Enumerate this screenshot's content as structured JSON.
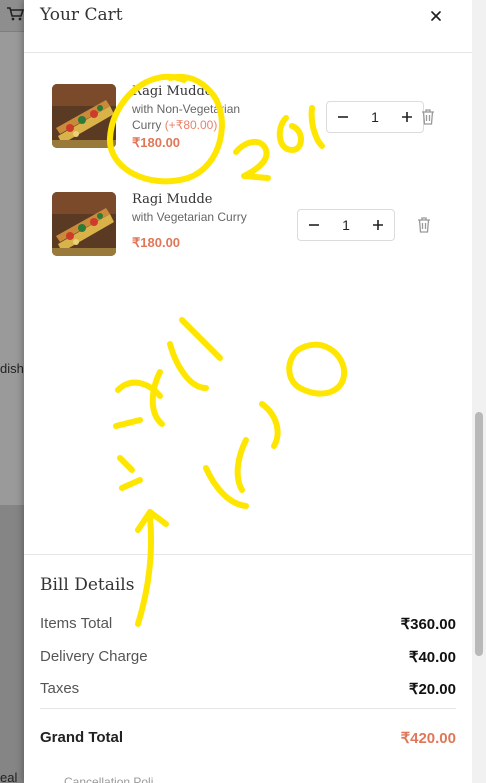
{
  "background": {
    "side_text_1": "dish",
    "side_text_2": "eal"
  },
  "cart": {
    "title": "Your Cart",
    "items": [
      {
        "name": "Ragi Mudde",
        "variant": "with Non-Vegetarian Curry",
        "addon": "(+₹80.00)",
        "price": "₹180.00",
        "quantity": "1"
      },
      {
        "name": "Ragi Mudde",
        "variant": "with Vegetarian Curry",
        "addon": "",
        "price": "₹180.00",
        "quantity": "1"
      }
    ]
  },
  "bill": {
    "title": "Bill Details",
    "rows": [
      {
        "label": "Items Total",
        "value": "₹360.00"
      },
      {
        "label": "Delivery Charge",
        "value": "₹40.00"
      },
      {
        "label": "Taxes",
        "value": "₹20.00"
      }
    ],
    "grand_total": {
      "label": "Grand Total",
      "value": "₹420.00"
    },
    "cancellation_hint": "Cancellation Poli"
  },
  "icons": {
    "cart": "cart-icon",
    "close": "close-icon",
    "minus": "minus-icon",
    "plus": "plus-icon",
    "trash": "trash-icon"
  },
  "colors": {
    "price": "#e07758",
    "annotation": "#ffe600",
    "overlay": "#9a9a9a"
  }
}
